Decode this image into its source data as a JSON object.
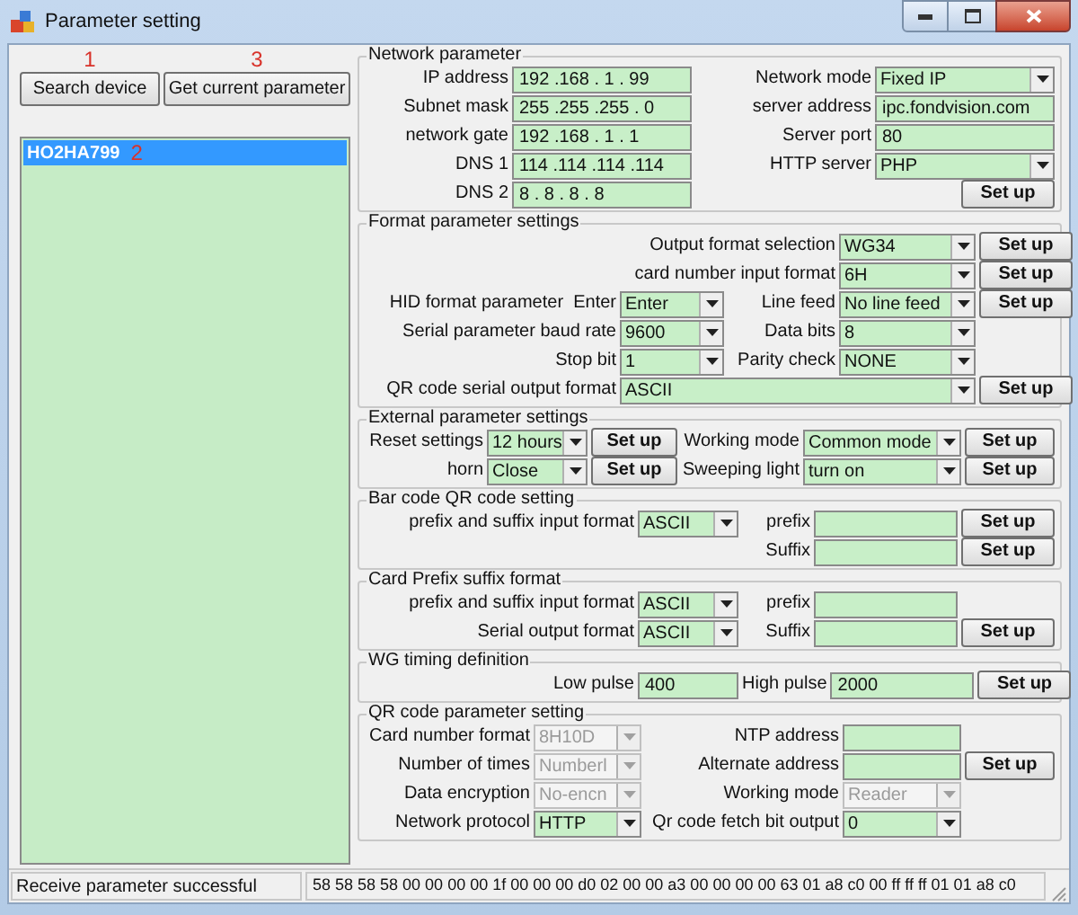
{
  "window": {
    "title": "Parameter setting"
  },
  "toolbar": {
    "buttons": [
      {
        "label": "Search device",
        "marker": "1"
      },
      {
        "label": "Get current parameter",
        "marker": "3"
      }
    ]
  },
  "device_list": {
    "items": [
      {
        "label": "HO2HA799",
        "marker": "2",
        "selected": true
      }
    ]
  },
  "groups": [
    {
      "title": "Network parameter",
      "rows": [
        [
          {
            "kind": "label",
            "text": "IP address"
          },
          {
            "kind": "input",
            "value": "192 .168 . 1 . 99"
          },
          {
            "kind": "label",
            "text": "Network mode"
          },
          {
            "kind": "select",
            "value": "Fixed IP",
            "disabled": false
          }
        ],
        [
          {
            "kind": "label",
            "text": "Subnet mask"
          },
          {
            "kind": "input",
            "value": "255 .255 .255 . 0"
          },
          {
            "kind": "label",
            "text": "server address"
          },
          {
            "kind": "input",
            "value": "ipc.fondvision.com"
          }
        ],
        [
          {
            "kind": "label",
            "text": "network gate"
          },
          {
            "kind": "input",
            "value": "192 .168 . 1 . 1"
          },
          {
            "kind": "label",
            "text": "Server port"
          },
          {
            "kind": "input",
            "value": "80"
          }
        ],
        [
          {
            "kind": "label",
            "text": "DNS 1"
          },
          {
            "kind": "input",
            "value": "114 .114 .114 .114"
          },
          {
            "kind": "label",
            "text": "HTTP server"
          },
          {
            "kind": "select",
            "value": "PHP",
            "disabled": false
          }
        ],
        [
          {
            "kind": "label",
            "text": "DNS 2"
          },
          {
            "kind": "input",
            "value": "8 . 8 . 8 . 8"
          },
          {
            "kind": "blank"
          },
          {
            "kind": "button",
            "text": "Set up"
          }
        ]
      ]
    },
    {
      "title": "Format parameter settings",
      "rows": [
        [
          {
            "kind": "label",
            "text": "Output format selection"
          },
          {
            "kind": "select",
            "value": "WG34",
            "disabled": false
          },
          {
            "kind": "button",
            "text": "Set up"
          }
        ],
        [
          {
            "kind": "label",
            "text": "card number input format"
          },
          {
            "kind": "select",
            "value": "6H",
            "disabled": false
          },
          {
            "kind": "button",
            "text": "Set up"
          }
        ],
        [
          {
            "kind": "label",
            "text": "HID format parameter  Enter"
          },
          {
            "kind": "select",
            "value": "Enter",
            "disabled": false
          },
          {
            "kind": "label",
            "text": "Line feed"
          },
          {
            "kind": "select",
            "value": "No line feed",
            "disabled": false
          },
          {
            "kind": "button",
            "text": "Set up"
          }
        ],
        [
          {
            "kind": "label",
            "text": "Serial parameter baud rate"
          },
          {
            "kind": "select",
            "value": "9600",
            "disabled": false
          },
          {
            "kind": "label",
            "text": "Data bits"
          },
          {
            "kind": "select",
            "value": "8",
            "disabled": false
          }
        ],
        [
          {
            "kind": "label",
            "text": "Stop bit"
          },
          {
            "kind": "select",
            "value": "1",
            "disabled": false
          },
          {
            "kind": "label",
            "text": "Parity check"
          },
          {
            "kind": "select",
            "value": "NONE",
            "disabled": false
          }
        ],
        [
          {
            "kind": "label",
            "text": "QR code serial output format"
          },
          {
            "kind": "select",
            "value": "ASCII",
            "disabled": false
          },
          {
            "kind": "button",
            "text": "Set up"
          }
        ]
      ]
    },
    {
      "title": "External parameter settings",
      "rows": [
        [
          {
            "kind": "label",
            "text": "Reset settings"
          },
          {
            "kind": "select",
            "value": "12 hours",
            "disabled": false
          },
          {
            "kind": "button",
            "text": "Set up"
          },
          {
            "kind": "label",
            "text": "Working mode"
          },
          {
            "kind": "select",
            "value": "Common mode",
            "disabled": false
          },
          {
            "kind": "button",
            "text": "Set up"
          }
        ],
        [
          {
            "kind": "label",
            "text": "horn"
          },
          {
            "kind": "select",
            "value": "Close",
            "disabled": false
          },
          {
            "kind": "button",
            "text": "Set up"
          },
          {
            "kind": "label",
            "text": "Sweeping light"
          },
          {
            "kind": "select",
            "value": "turn on",
            "disabled": false
          },
          {
            "kind": "button",
            "text": "Set up"
          }
        ]
      ]
    },
    {
      "title": "Bar code QR code setting",
      "rows": [
        [
          {
            "kind": "label",
            "text": "prefix and suffix input format"
          },
          {
            "kind": "select",
            "value": "ASCII",
            "disabled": false
          },
          {
            "kind": "label",
            "text": "prefix"
          },
          {
            "kind": "input"
          },
          {
            "kind": "button",
            "text": "Set up"
          }
        ],
        [
          {
            "kind": "blank"
          },
          {
            "kind": "blank"
          },
          {
            "kind": "label",
            "text": "Suffix"
          },
          {
            "kind": "input"
          },
          {
            "kind": "button",
            "text": "Set up"
          }
        ]
      ]
    },
    {
      "title": "Card Prefix suffix format",
      "rows": [
        [
          {
            "kind": "label",
            "text": "prefix and suffix input format"
          },
          {
            "kind": "select",
            "value": "ASCII",
            "disabled": false
          },
          {
            "kind": "label",
            "text": "prefix"
          },
          {
            "kind": "input"
          }
        ],
        [
          {
            "kind": "label",
            "text": "Serial output format"
          },
          {
            "kind": "select",
            "value": "ASCII",
            "disabled": false
          },
          {
            "kind": "label",
            "text": "Suffix"
          },
          {
            "kind": "input"
          },
          {
            "kind": "button",
            "text": "Set up"
          }
        ]
      ]
    },
    {
      "title": "WG timing definition",
      "rows": [
        [
          {
            "kind": "label",
            "text": "Low pulse"
          },
          {
            "kind": "input",
            "value": "400"
          },
          {
            "kind": "label",
            "text": "High pulse"
          },
          {
            "kind": "input",
            "value": "2000"
          },
          {
            "kind": "button",
            "text": "Set up"
          }
        ]
      ]
    },
    {
      "title": "QR code parameter setting",
      "rows": [
        [
          {
            "kind": "label",
            "text": "Card number format"
          },
          {
            "kind": "select",
            "value": "8H10D",
            "disabled": true
          },
          {
            "kind": "label",
            "text": "NTP address"
          },
          {
            "kind": "input"
          }
        ],
        [
          {
            "kind": "label",
            "text": "Number of times"
          },
          {
            "kind": "select",
            "value": "Numberl",
            "disabled": true
          },
          {
            "kind": "label",
            "text": "Alternate address"
          },
          {
            "kind": "input"
          },
          {
            "kind": "button",
            "text": "Set up"
          }
        ],
        [
          {
            "kind": "label",
            "text": "Data encryption"
          },
          {
            "kind": "select",
            "value": "No-encn",
            "disabled": true
          },
          {
            "kind": "label",
            "text": "Working mode"
          },
          {
            "kind": "select",
            "value": "Reader",
            "disabled": true
          }
        ],
        [
          {
            "kind": "label",
            "text": "Network protocol"
          },
          {
            "kind": "select",
            "value": "HTTP",
            "disabled": false
          },
          {
            "kind": "label",
            "text": "Qr code fetch bit output"
          },
          {
            "kind": "select",
            "value": "0",
            "disabled": false
          }
        ]
      ]
    }
  ],
  "status_bar": {
    "message": "Receive parameter successful",
    "data": "58 58 58 58 00 00 00 00 1f 00 00 00 d0 02 00 00 a3 00 00 00 00 63 01 a8 c0 00 ff ff ff 01 01 a8 c0"
  }
}
